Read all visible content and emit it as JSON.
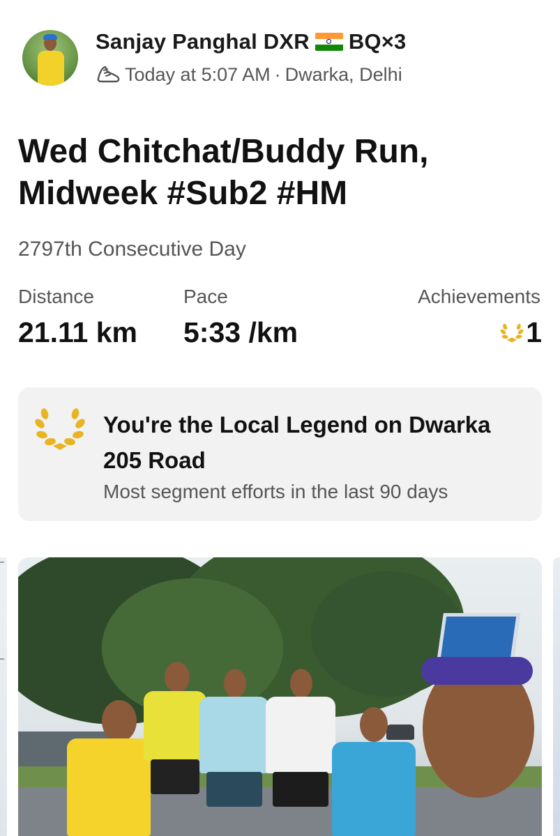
{
  "athlete": {
    "name": "Sanjay Panghal DXR",
    "name_suffix": "BQ×3"
  },
  "activity_meta": {
    "time": "Today at 5:07 AM",
    "separator": "·",
    "location": "Dwarka, Delhi"
  },
  "activity": {
    "title": "Wed Chitchat/Buddy Run, Midweek #Sub2 #HM",
    "subtitle": "2797th Consecutive Day"
  },
  "stats": {
    "distance_label": "Distance",
    "distance_value": "21.11 km",
    "pace_label": "Pace",
    "pace_value": "5:33 /km",
    "achievements_label": "Achievements",
    "achievements_value": "1"
  },
  "local_legend": {
    "title": "You're the Local Legend on Dwarka 205 Road",
    "subtitle": "Most segment efforts in the last 90 days"
  },
  "colors": {
    "laurel_gold": "#e8b423",
    "card_bg": "#f2f2f2",
    "muted_text": "#555555"
  },
  "icons": {
    "shoe": "running-shoe-icon",
    "laurel": "laurel-wreath-icon",
    "flag": "india-flag-icon"
  }
}
